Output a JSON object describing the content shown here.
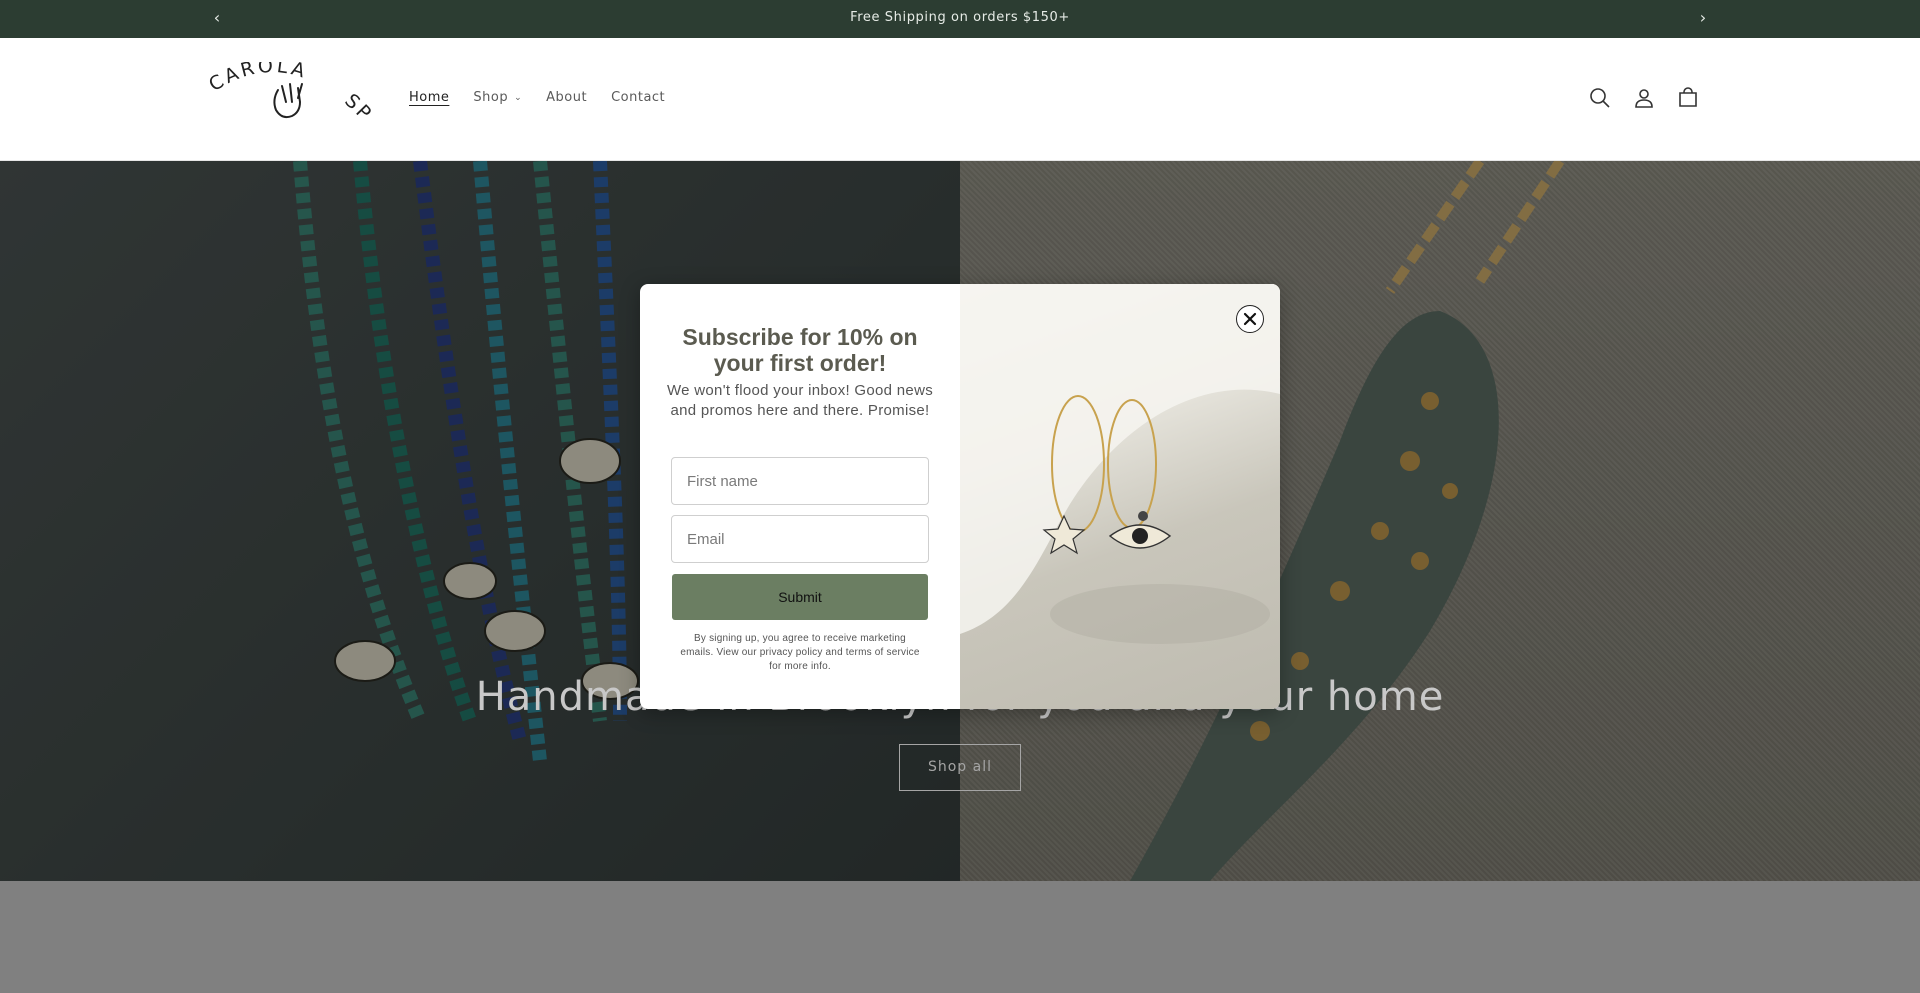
{
  "announcement": {
    "message": "Free Shipping on orders $150+",
    "prev_icon": "chevron-left-icon",
    "next_icon": "chevron-right-icon"
  },
  "header": {
    "logo_text": "CAROLA SPITZER",
    "nav": [
      {
        "label": "Home",
        "active": true
      },
      {
        "label": "Shop",
        "has_dropdown": true
      },
      {
        "label": "About"
      },
      {
        "label": "Contact"
      }
    ],
    "icons": [
      "search-icon",
      "account-icon",
      "cart-icon"
    ]
  },
  "hero": {
    "title": "Handmade in Brooklyn for you and your home",
    "button_label": "Shop all"
  },
  "modal": {
    "title": "Subscribe for 10% on your first order!",
    "subtitle": "We won't flood your inbox! Good news and promos here and there. Promise!",
    "first_name_placeholder": "First name",
    "email_placeholder": "Email",
    "submit_label": "Submit",
    "fine_print": "By signing up, you agree to receive marketing emails. View our privacy policy and terms of service for more info.",
    "close_icon": "close-icon"
  },
  "colors": {
    "announcement_bg": "#2c3d32",
    "submit_bg": "#6b7e62"
  }
}
